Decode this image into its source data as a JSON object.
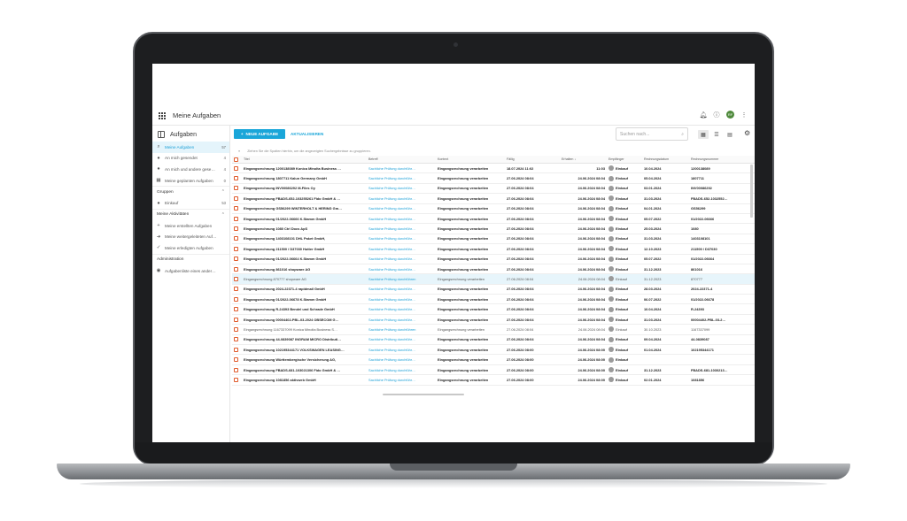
{
  "app": {
    "title": "Meine Aufgaben",
    "avatar_initials": "RF",
    "accent_color": "#1aa6d9"
  },
  "sidebar": {
    "heading": "Aufgaben",
    "items": [
      {
        "label": "Meine Aufgaben",
        "count": "57",
        "icon": "search-icon",
        "active": true
      },
      {
        "label": "An mich gesendet",
        "count": "4",
        "icon": "person-icon"
      },
      {
        "label": "An mich und andere gese…",
        "count": "4",
        "icon": "people-icon"
      },
      {
        "label": "Meine geplanten Aufgaben",
        "count": "0",
        "icon": "calendar-icon"
      }
    ],
    "groups_label": "Gruppen",
    "groups": [
      {
        "label": "Einkauf",
        "count": "53",
        "icon": "people-icon"
      }
    ],
    "activities_label": "Meine Aktivitäten",
    "activities": [
      {
        "label": "Meine erstellten Aufgaben",
        "icon": "plus-icon"
      },
      {
        "label": "Meine weitergeleiteten Auf…",
        "icon": "forward-icon"
      },
      {
        "label": "Meine erledigten Aufgaben",
        "icon": "check-icon"
      }
    ],
    "admin_label": "Administration",
    "admin": [
      {
        "label": "Aufgabenliste eines ander…",
        "icon": "account-icon"
      }
    ]
  },
  "toolbar": {
    "new_task": "NEUE AUFGABE",
    "refresh": "AKTUALISIEREN",
    "search_placeholder": "Suchen nach..."
  },
  "group_hint": "Ziehen Sie die Spalten hierhin, um die angezeigten Suchergebnisse zu gruppieren.",
  "table": {
    "headers": [
      "Titel",
      "Betreff",
      "Kontext",
      "Fällig",
      "Erhalten",
      "Empfänger",
      "Rechnungsdatum",
      "Rechnungsnummer"
    ],
    "rows": [
      {
        "titel": "Eingangsrechnung 1200138089 Konica Minolta Business …",
        "betreff": "Sachliche Prüfung durchführ…",
        "kontext": "Eingangsrechnung verarbeiten",
        "faellig": "18.07.2024 11:02",
        "erhalten": "11:03",
        "empfaenger": "Einkauf",
        "rdatum": "10.04.2024",
        "rnummer": "1200138089",
        "style": "bold"
      },
      {
        "titel": "Eingangsrechnung 1807711 Kalun Germany GmbH",
        "betreff": "Sachliche Prüfung durchführ…",
        "kontext": "Eingangsrechnung verarbeiten",
        "faellig": "27.06.2024 08:04",
        "erhalten": "24.06.2024 08:04",
        "empfaenger": "Einkauf",
        "rdatum": "05.04.2024",
        "rnummer": "1807711",
        "style": "bold"
      },
      {
        "titel": "Eingangsrechnung INV00086292 M-Files Oy",
        "betreff": "Sachliche Prüfung durchführ…",
        "kontext": "Eingangsrechnung verarbeiten",
        "faellig": "27.06.2024 08:04",
        "erhalten": "24.06.2024 08:04",
        "empfaenger": "Einkauf",
        "rdatum": "03.01.2024",
        "rnummer": "INV00086292",
        "style": "bold"
      },
      {
        "titel": "Eingangsrechnung FBADS-652-103255261 Fido GmbH & …",
        "betreff": "Sachliche Prüfung durchführ…",
        "kontext": "Eingangsrechnung verarbeiten",
        "faellig": "27.06.2024 08:04",
        "erhalten": "24.06.2024 08:04",
        "empfaenger": "Einkauf",
        "rdatum": "31.03.2024",
        "rnummer": "FBADS-652-1032552…",
        "style": "bold"
      },
      {
        "titel": "Eingangsrechnung GS56299 WINTERHOLT & HERING Gm…",
        "betreff": "Sachliche Prüfung durchführ…",
        "kontext": "Eingangsrechnung verarbeiten",
        "faellig": "27.06.2024 08:04",
        "erhalten": "24.06.2024 08:04",
        "empfaenger": "Einkauf",
        "rdatum": "04.01.2024",
        "rnummer": "GS56299",
        "style": "bold"
      },
      {
        "titel": "Eingangsrechnung 01/2022-06666 K.Stamm GmbH",
        "betreff": "Sachliche Prüfung durchführ…",
        "kontext": "Eingangsrechnung verarbeiten",
        "faellig": "27.06.2024 08:04",
        "erhalten": "24.06.2024 08:04",
        "empfaenger": "Einkauf",
        "rdatum": "05.07.2022",
        "rnummer": "01/2022-06666",
        "style": "bold"
      },
      {
        "titel": "Eingangsrechnung 1080 Ctrl Docs ApS",
        "betreff": "Sachliche Prüfung durchführ…",
        "kontext": "Eingangsrechnung verarbeiten",
        "faellig": "27.06.2024 08:04",
        "erhalten": "24.06.2024 08:04",
        "empfaenger": "Einkauf",
        "rdatum": "25.03.2024",
        "rnummer": "1080",
        "style": "bold"
      },
      {
        "titel": "Eingangsrechnung 1403108101 DHL Paket GmbH,",
        "betreff": "Sachliche Prüfung durchführ…",
        "kontext": "Eingangsrechnung verarbeiten",
        "faellig": "27.06.2024 08:04",
        "erhalten": "24.06.2024 08:04",
        "empfaenger": "Einkauf",
        "rdatum": "31.03.2024",
        "rnummer": "1403108101",
        "style": "bold"
      },
      {
        "titel": "Eingangsrechnung 211500 / D37030 Hutter GmbH",
        "betreff": "Sachliche Prüfung durchführ…",
        "kontext": "Eingangsrechnung verarbeiten",
        "faellig": "27.06.2024 08:04",
        "erhalten": "24.06.2024 08:04",
        "empfaenger": "Einkauf",
        "rdatum": "12.10.2023",
        "rnummer": "211500 / D37030",
        "style": "bold"
      },
      {
        "titel": "Eingangsrechnung 01/2022-06664 K.Stamm GmbH",
        "betreff": "Sachliche Prüfung durchführ…",
        "kontext": "Eingangsrechnung verarbeiten",
        "faellig": "27.06.2024 08:04",
        "erhalten": "24.06.2024 08:04",
        "empfaenger": "Einkauf",
        "rdatum": "05.07.2022",
        "rnummer": "01/2022-06664",
        "style": "bold"
      },
      {
        "titel": "Eingangsrechnung 861016 shopware AG",
        "betreff": "Sachliche Prüfung durchführ…",
        "kontext": "Eingangsrechnung verarbeiten",
        "faellig": "27.06.2024 08:04",
        "erhalten": "24.06.2024 08:04",
        "empfaenger": "Einkauf",
        "rdatum": "31.12.2023",
        "rnummer": "861016",
        "style": "bold"
      },
      {
        "titel": "Eingangsrechnung 870777 shopware AG",
        "betreff": "Sachliche Prüfung durchführen",
        "kontext": "Eingangsrechnung verarbeiten",
        "faellig": "27.06.2024 08:04",
        "erhalten": "24.06.2024 08:04",
        "empfaenger": "Einkauf",
        "rdatum": "31.12.2023",
        "rnummer": "870777",
        "style": "normal",
        "selected": true
      },
      {
        "titel": "Eingangsrechnung 2024-22371-4 rapidmail GmbH",
        "betreff": "Sachliche Prüfung durchführ…",
        "kontext": "Eingangsrechnung verarbeiten",
        "faellig": "27.06.2024 08:04",
        "erhalten": "24.06.2024 08:04",
        "empfaenger": "Einkauf",
        "rdatum": "28.03.2024",
        "rnummer": "2024-22371-4",
        "style": "bold"
      },
      {
        "titel": "Eingangsrechnung 01/2022-06678 K.Stamm GmbH",
        "betreff": "Sachliche Prüfung durchführ…",
        "kontext": "Eingangsrechnung verarbeiten",
        "faellig": "27.06.2024 08:04",
        "erhalten": "24.06.2024 08:04",
        "empfaenger": "Einkauf",
        "rdatum": "06.07.2022",
        "rnummer": "01/2022-06678",
        "style": "bold"
      },
      {
        "titel": "Eingangsrechnung R-24393 Bendel und Schrade GmbH",
        "betreff": "Sachliche Prüfung durchführ…",
        "kontext": "Eingangsrechnung verarbeiten",
        "faellig": "27.06.2024 08:04",
        "erhalten": "24.06.2024 08:04",
        "empfaenger": "Einkauf",
        "rdatum": "10.04.2024",
        "rnummer": "R-24393",
        "style": "bold"
      },
      {
        "titel": "Eingangsrechnung 00004402-PBL-03-2024 OBSECOM G…",
        "betreff": "Sachliche Prüfung durchführ…",
        "kontext": "Eingangsrechnung verarbeiten",
        "faellig": "27.06.2024 08:04",
        "erhalten": "24.06.2024 08:04",
        "empfaenger": "Einkauf",
        "rdatum": "31.03.2024",
        "rnummer": "00004402-PBL-03-2…",
        "style": "bold"
      },
      {
        "titel": "Eingangsrechnung 1167337099 Konica Minolta Business S…",
        "betreff": "Sachliche Prüfung durchführen",
        "kontext": "Eingangsrechnung verarbeiten",
        "faellig": "27.06.2024 08:04",
        "erhalten": "24.06.2024 08:04",
        "empfaenger": "Einkauf",
        "rdatum": "30.10.2023",
        "rnummer": "1167337099",
        "style": "normal"
      },
      {
        "titel": "Eingangsrechnung 44-0839087 INGRAM MICRO Distributi…",
        "betreff": "Sachliche Prüfung durchführ…",
        "kontext": "Eingangsrechnung verarbeiten",
        "faellig": "27.06.2024 08:04",
        "erhalten": "24.06.2024 08:04",
        "empfaenger": "Einkauf",
        "rdatum": "09.04.2024",
        "rnummer": "44-0839087",
        "style": "bold"
      },
      {
        "titel": "Eingangsrechnung 102195344171 VOLKSWAGEN LEASING…",
        "betreff": "Sachliche Prüfung durchführ…",
        "kontext": "Eingangsrechnung verarbeiten",
        "faellig": "27.06.2024 08:00",
        "erhalten": "24.06.2024 08:00",
        "empfaenger": "Einkauf",
        "rdatum": "01.04.2024",
        "rnummer": "102195344171",
        "style": "bold"
      },
      {
        "titel": "Eingangsrechnung Württembergische Versicherung AG,",
        "betreff": "Sachliche Prüfung durchführ…",
        "kontext": "Eingangsrechnung verarbeiten",
        "faellig": "27.06.2024 08:00",
        "erhalten": "24.06.2024 08:00",
        "empfaenger": "Einkauf",
        "rdatum": "",
        "rnummer": "",
        "style": "bold"
      },
      {
        "titel": "Eingangsrechnung FBADS-681-103021306 Fido GmbH & …",
        "betreff": "Sachliche Prüfung durchführ…",
        "kontext": "Eingangsrechnung verarbeiten",
        "faellig": "27.06.2024 08:00",
        "erhalten": "24.06.2024 08:00",
        "empfaenger": "Einkauf",
        "rdatum": "31.12.2023",
        "rnummer": "FBADS-681-1030213…",
        "style": "bold"
      },
      {
        "titel": "Eingangsrechnung 1081856 aktivweb GmbH",
        "betreff": "Sachliche Prüfung durchführ…",
        "kontext": "Eingangsrechnung verarbeiten",
        "faellig": "27.06.2024 08:00",
        "erhalten": "24.06.2024 08:00",
        "empfaenger": "Einkauf",
        "rdatum": "02.01.2024",
        "rnummer": "1081856",
        "style": "bold"
      }
    ]
  }
}
